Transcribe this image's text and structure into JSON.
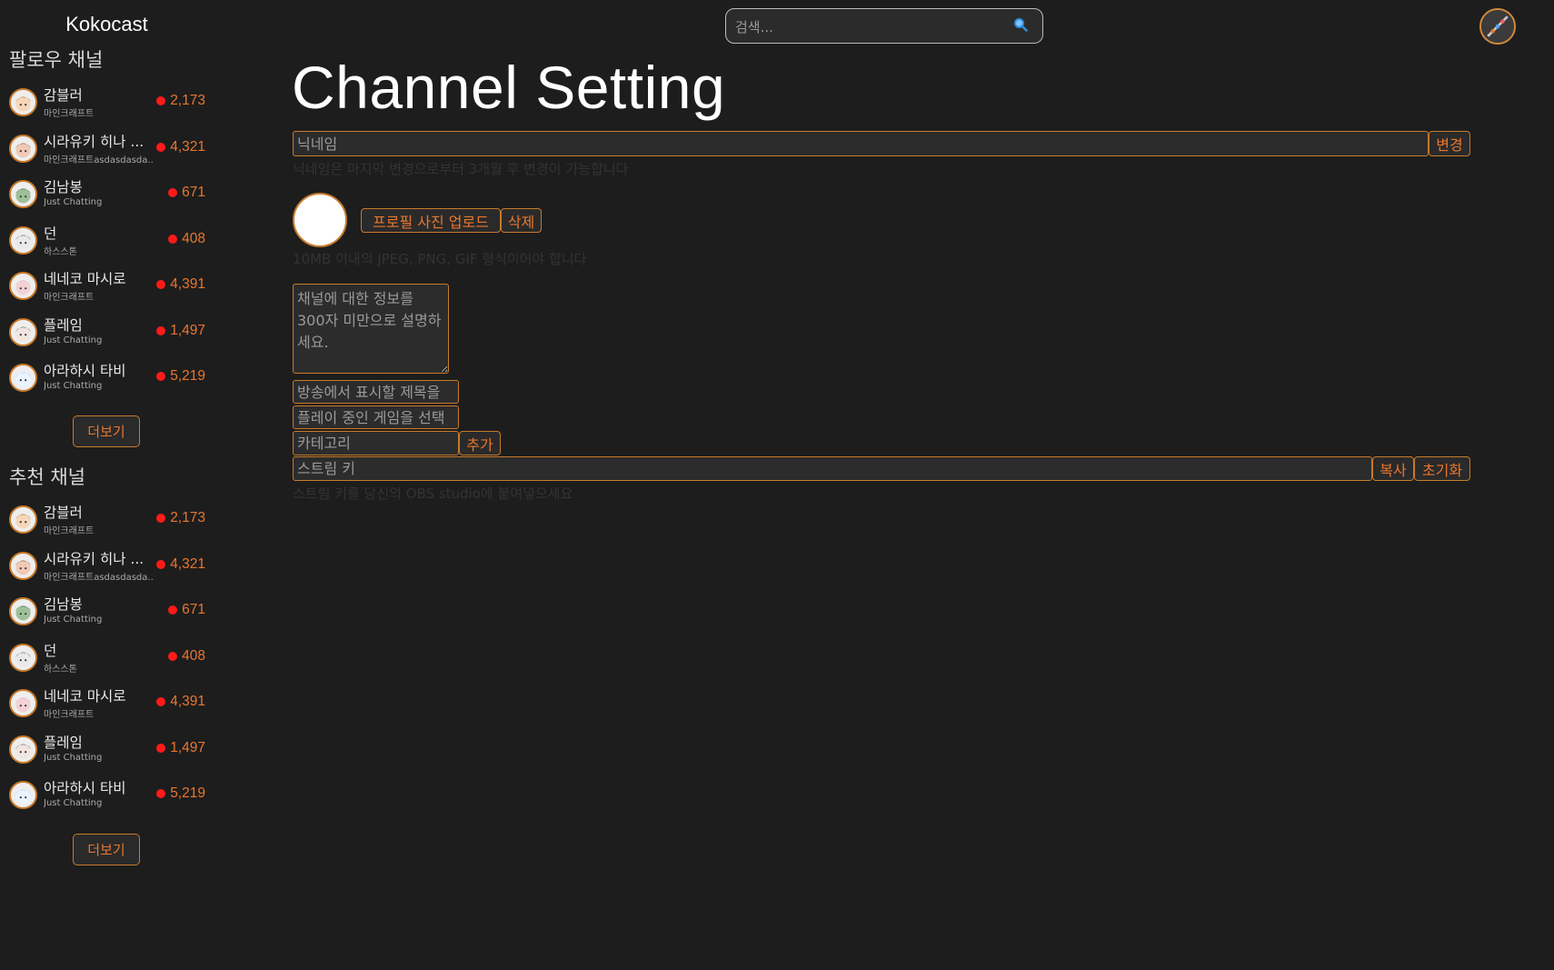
{
  "app": {
    "title": "Kokocast"
  },
  "search": {
    "placeholder": "검색...",
    "icon": "search-icon"
  },
  "sidebar": {
    "follow_title": "팔로우 채널",
    "recommend_title": "추천 채널",
    "more_label": "더보기",
    "follow_channels": [
      {
        "name": "감블러",
        "category": "마인크래프트",
        "viewers": "2,173",
        "avatar": "avatar-1"
      },
      {
        "name": "시라유키 히나 ...",
        "category": "마인크래프트asdasdasda...",
        "viewers": "4,321",
        "avatar": "avatar-2"
      },
      {
        "name": "김남봉",
        "category": "Just Chatting",
        "viewers": "671",
        "avatar": "avatar-3"
      },
      {
        "name": "던",
        "category": "하스스톤",
        "viewers": "408",
        "avatar": "avatar-4"
      },
      {
        "name": "네네코 마시로",
        "category": "마인크래프트",
        "viewers": "4,391",
        "avatar": "avatar-5"
      },
      {
        "name": "플레임",
        "category": "Just Chatting",
        "viewers": "1,497",
        "avatar": "avatar-6"
      },
      {
        "name": "아라하시 타비",
        "category": "Just Chatting",
        "viewers": "5,219",
        "avatar": "avatar-7"
      }
    ],
    "recommend_channels": [
      {
        "name": "감블러",
        "category": "마인크래프트",
        "viewers": "2,173",
        "avatar": "avatar-1"
      },
      {
        "name": "시라유키 히나 ...",
        "category": "마인크래프트asdasdasda...",
        "viewers": "4,321",
        "avatar": "avatar-2"
      },
      {
        "name": "김남봉",
        "category": "Just Chatting",
        "viewers": "671",
        "avatar": "avatar-3"
      },
      {
        "name": "던",
        "category": "하스스톤",
        "viewers": "408",
        "avatar": "avatar-4"
      },
      {
        "name": "네네코 마시로",
        "category": "마인크래프트",
        "viewers": "4,391",
        "avatar": "avatar-5"
      },
      {
        "name": "플레임",
        "category": "Just Chatting",
        "viewers": "1,497",
        "avatar": "avatar-6"
      },
      {
        "name": "아라하시 타비",
        "category": "Just Chatting",
        "viewers": "5,219",
        "avatar": "avatar-7"
      }
    ]
  },
  "main": {
    "title": "Channel Setting",
    "nickname": {
      "placeholder": "닉네임",
      "button": "변경",
      "hint": "닉네임은 마지막 변경으로부터 3개월 후 변경이 가능합니다"
    },
    "profile": {
      "upload_button": "프로필 사진 업로드",
      "delete_button": "삭제",
      "hint": "10MB 이내의 JPEG, PNG, GIF 형식이어야 합니다"
    },
    "description": {
      "placeholder": "채널에 대한 정보를 300자 미만으로 설명하세요."
    },
    "stream_title": {
      "placeholder": "방송에서 표시할 제목을"
    },
    "game": {
      "placeholder": "플레이 중인 게임을 선택"
    },
    "category": {
      "placeholder": "카테고리",
      "button": "추가"
    },
    "stream_key": {
      "placeholder": "스트림 키",
      "copy_button": "복사",
      "reset_button": "초기화",
      "hint": "스트림 키를 당신의 OBS studio에 붙여넣으세요"
    }
  },
  "colors": {
    "accent": "#e8772e",
    "border": "#c77a2a",
    "live": "#ff1a1a",
    "background": "#1d1d1d"
  }
}
